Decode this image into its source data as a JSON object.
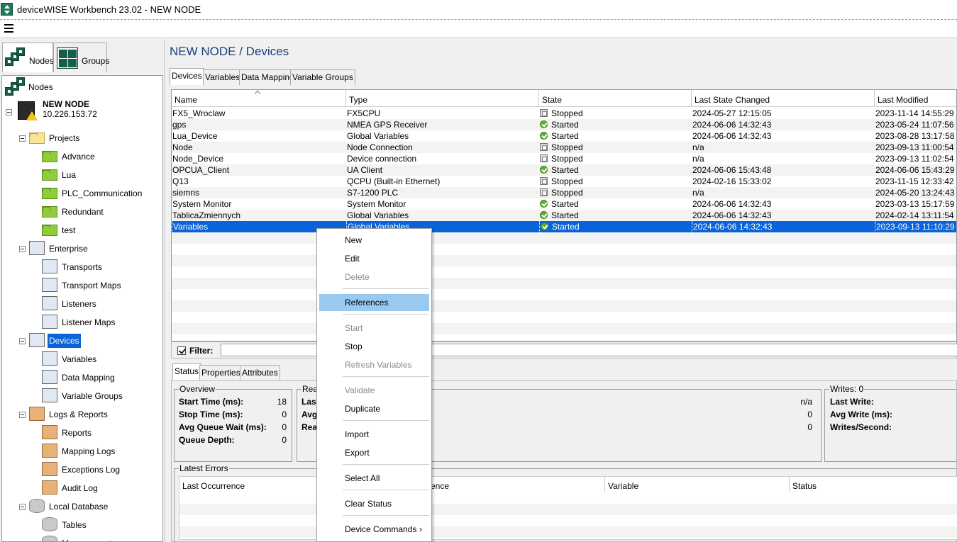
{
  "window": {
    "title": "deviceWISE Workbench 23.02  -  NEW NODE"
  },
  "left_tabs": [
    {
      "label": "Nodes"
    },
    {
      "label": "Groups"
    }
  ],
  "tree": {
    "root_label": "Nodes",
    "node": {
      "name": "NEW NODE",
      "address": "10.226.153.72"
    },
    "items": [
      {
        "label": "Projects",
        "icon": "folder-yellow"
      },
      {
        "label": "Advance",
        "icon": "folder-green"
      },
      {
        "label": "Lua",
        "icon": "folder-green"
      },
      {
        "label": "PLC_Communication",
        "icon": "folder-green"
      },
      {
        "label": "Redundant",
        "icon": "folder-green"
      },
      {
        "label": "test",
        "icon": "folder-green"
      },
      {
        "label": "Enterprise",
        "icon": "enterprise-icon"
      },
      {
        "label": "Transports",
        "icon": "transports-icon"
      },
      {
        "label": "Transport Maps",
        "icon": "transport-maps-icon"
      },
      {
        "label": "Listeners",
        "icon": "listeners-icon"
      },
      {
        "label": "Listener Maps",
        "icon": "listener-maps-icon"
      },
      {
        "label": "Devices",
        "icon": "devices-icon"
      },
      {
        "label": "Variables",
        "icon": "variables-icon"
      },
      {
        "label": "Data Mapping",
        "icon": "data-mapping-icon"
      },
      {
        "label": "Variable Groups",
        "icon": "variable-groups-icon"
      },
      {
        "label": "Logs & Reports",
        "icon": "logs-icon"
      },
      {
        "label": "Reports",
        "icon": "report-icon"
      },
      {
        "label": "Mapping Logs",
        "icon": "report-icon"
      },
      {
        "label": "Exceptions Log",
        "icon": "report-icon"
      },
      {
        "label": "Audit Log",
        "icon": "report-icon"
      },
      {
        "label": "Local Database",
        "icon": "database-icon"
      },
      {
        "label": "Tables",
        "icon": "table-icon"
      },
      {
        "label": "Management",
        "icon": "database-icon"
      }
    ]
  },
  "main": {
    "heading": "NEW NODE / Devices",
    "tabs": [
      {
        "label": "Devices"
      },
      {
        "label": "Variables"
      },
      {
        "label": "Data Mapping"
      },
      {
        "label": "Variable Groups"
      }
    ],
    "columns": [
      "Name",
      "Type",
      "State",
      "Last State Changed",
      "Last Modified"
    ],
    "rows": [
      {
        "name": "FX5_Wroclaw",
        "type": "FX5CPU",
        "state": "Stopped",
        "changed": "2024-05-27 12:15:05",
        "modified": "2023-11-14 14:55:29"
      },
      {
        "name": "gps",
        "type": "NMEA GPS Receiver",
        "state": "Started",
        "changed": "2024-06-06 14:32:43",
        "modified": "2023-05-24 11:07:56"
      },
      {
        "name": "Lua_Device",
        "type": "Global Variables",
        "state": "Started",
        "changed": "2024-06-06 14:32:43",
        "modified": "2023-08-28 13:17:58"
      },
      {
        "name": "Node",
        "type": "Node Connection",
        "state": "Stopped",
        "changed": "n/a",
        "modified": "2023-09-13 11:00:54"
      },
      {
        "name": "Node_Device",
        "type": "Device connection",
        "state": "Stopped",
        "changed": "n/a",
        "modified": "2023-09-13 11:02:54"
      },
      {
        "name": "OPCUA_Client",
        "type": "UA Client",
        "state": "Started",
        "changed": "2024-06-06 15:43:48",
        "modified": "2024-06-06 15:43:29"
      },
      {
        "name": "Q13",
        "type": "QCPU (Built-in Ethernet)",
        "state": "Stopped",
        "changed": "2024-02-16 15:33:02",
        "modified": "2023-11-15 12:33:42"
      },
      {
        "name": "siemns",
        "type": "S7-1200 PLC",
        "state": "Stopped",
        "changed": "n/a",
        "modified": "2024-05-20 13:24:43"
      },
      {
        "name": "System Monitor",
        "type": "System Monitor",
        "state": "Started",
        "changed": "2024-06-06 14:32:43",
        "modified": "2023-03-13 15:17:59"
      },
      {
        "name": "TablicaZmiennych",
        "type": "Global Variables",
        "state": "Started",
        "changed": "2024-06-06 14:32:43",
        "modified": "2024-02-14 13:11:54"
      },
      {
        "name": "Variables",
        "type": "Global Variables",
        "state": "Started",
        "changed": "2024-06-06 14:32:43",
        "modified": "2023-09-13 11:10:29"
      }
    ],
    "selected_row": 10,
    "filter": {
      "label": "Filter:",
      "value": ""
    }
  },
  "bottom": {
    "tabs": [
      {
        "label": "Status"
      },
      {
        "label": "Properties"
      },
      {
        "label": "Attributes"
      }
    ],
    "overview": {
      "title": "Overview",
      "rows": [
        {
          "k": "Start Time (ms):",
          "v": "18"
        },
        {
          "k": "Stop Time (ms):",
          "v": "0"
        },
        {
          "k": "Avg Queue Wait (ms):",
          "v": "0"
        },
        {
          "k": "Queue Depth:",
          "v": "0"
        }
      ]
    },
    "reads": {
      "title": "Rea",
      "rows": [
        {
          "k": "Las",
          "v": "n/a"
        },
        {
          "k": "Avg",
          "v": "0"
        },
        {
          "k": "Rea",
          "v": "0"
        }
      ]
    },
    "writes": {
      "title": "Writes: 0",
      "rows": [
        {
          "k": "Last Write:"
        },
        {
          "k": "Avg Write (ms):"
        },
        {
          "k": "Writes/Second:"
        }
      ]
    },
    "errors": {
      "title": "Latest Errors",
      "columns": [
        "Last Occurrence",
        "ence",
        "Variable",
        "Status"
      ]
    }
  },
  "context_menu": {
    "items": [
      {
        "label": "New",
        "enabled": true
      },
      {
        "label": "Edit",
        "enabled": true
      },
      {
        "label": "Delete",
        "enabled": false
      },
      {
        "label": "References",
        "enabled": true,
        "highlighted": true
      },
      {
        "label": "Start",
        "enabled": false
      },
      {
        "label": "Stop",
        "enabled": true
      },
      {
        "label": "Refresh Variables",
        "enabled": false
      },
      {
        "label": "Validate",
        "enabled": false
      },
      {
        "label": "Duplicate",
        "enabled": true
      },
      {
        "label": "Import",
        "enabled": true
      },
      {
        "label": "Export",
        "enabled": true
      },
      {
        "label": "Select All",
        "enabled": true
      },
      {
        "label": "Clear Status",
        "enabled": true
      },
      {
        "label": "Device Commands",
        "enabled": true,
        "submenu": true,
        "arrow": "›"
      }
    ]
  },
  "colors": {
    "selection": "#0a64d8",
    "menu_highlight": "#99c9ef",
    "heading": "#1a3f7a",
    "started": "#5fae2b"
  }
}
